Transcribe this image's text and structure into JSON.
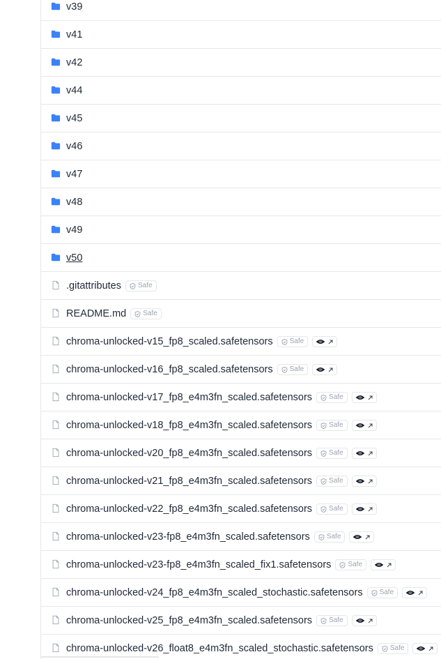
{
  "folders": [
    "v39",
    "v41",
    "v42",
    "v44",
    "v45",
    "v46",
    "v47",
    "v48",
    "v49",
    "v50"
  ],
  "hovered_folder_index": 9,
  "files": [
    {
      "name": ".gitattributes",
      "safe_label": "Safe",
      "xet": false
    },
    {
      "name": "README.md",
      "safe_label": "Safe",
      "xet": false
    },
    {
      "name": "chroma-unlocked-v15_fp8_scaled.safetensors",
      "safe_label": "Safe",
      "xet": true
    },
    {
      "name": "chroma-unlocked-v16_fp8_scaled.safetensors",
      "safe_label": "Safe",
      "xet": true
    },
    {
      "name": "chroma-unlocked-v17_fp8_e4m3fn_scaled.safetensors",
      "safe_label": "Safe",
      "xet": true
    },
    {
      "name": "chroma-unlocked-v18_fp8_e4m3fn_scaled.safetensors",
      "safe_label": "Safe",
      "xet": true
    },
    {
      "name": "chroma-unlocked-v20_fp8_e4m3fn_scaled.safetensors",
      "safe_label": "Safe",
      "xet": true
    },
    {
      "name": "chroma-unlocked-v21_fp8_e4m3fn_scaled.safetensors",
      "safe_label": "Safe",
      "xet": true
    },
    {
      "name": "chroma-unlocked-v22_fp8_e4m3fn_scaled.safetensors",
      "safe_label": "Safe",
      "xet": true
    },
    {
      "name": "chroma-unlocked-v23-fp8_e4m3fn_scaled.safetensors",
      "safe_label": "Safe",
      "xet": true
    },
    {
      "name": "chroma-unlocked-v23-fp8_e4m3fn_scaled_fix1.safetensors",
      "safe_label": "Safe",
      "xet": true
    },
    {
      "name": "chroma-unlocked-v24_fp8_e4m3fn_scaled_stochastic.safetensors",
      "safe_label": "Safe",
      "xet": true
    },
    {
      "name": "chroma-unlocked-v25_fp8_e4m3fn_scaled.safetensors",
      "safe_label": "Safe",
      "xet": true
    },
    {
      "name": "chroma-unlocked-v26_float8_e4m3fn_scaled_stochastic.safetensors",
      "safe_label": "Safe",
      "xet": true
    }
  ],
  "icons": {
    "folder": "folder-icon",
    "file": "file-icon",
    "safe": "shield-check-icon",
    "xet": "xet-storage-icon",
    "external": "external-link-icon"
  },
  "colors": {
    "folder": "#3b82f6",
    "text": "#1f2937",
    "border": "#e5e7eb",
    "badge_text": "#9ca3af"
  }
}
